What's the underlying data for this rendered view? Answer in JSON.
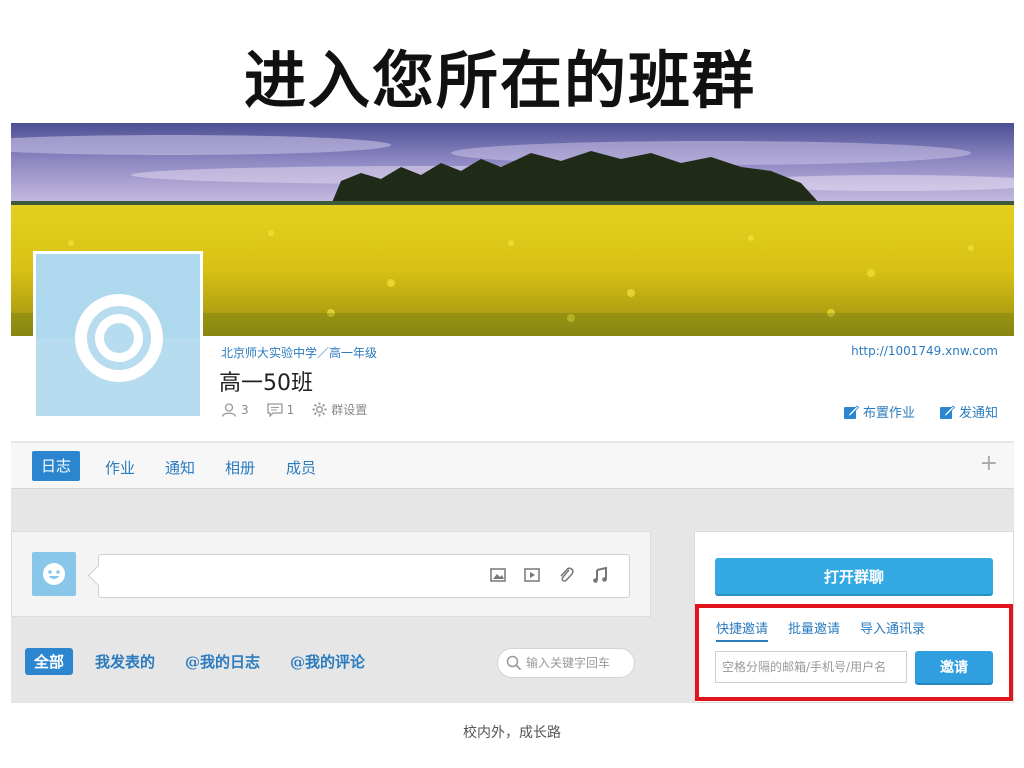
{
  "slide": {
    "title": "进入您所在的班群",
    "footer": "校内外，成长路"
  },
  "header": {
    "school_path": "北京师大实验中学／高一年级",
    "class_name": "高一50班",
    "url": "http://1001749.xnw.com",
    "stats": {
      "members": "3",
      "messages": "1",
      "settings_label": "群设置"
    },
    "actions": {
      "assign_homework": "布置作业",
      "send_notice": "发通知"
    }
  },
  "tabs": [
    {
      "label": "日志",
      "active": true
    },
    {
      "label": "作业",
      "active": false
    },
    {
      "label": "通知",
      "active": false
    },
    {
      "label": "相册",
      "active": false
    },
    {
      "label": "成员",
      "active": false
    }
  ],
  "tab_add": "+",
  "filters": [
    {
      "label": "全部",
      "active": true
    },
    {
      "label": "我发表的",
      "active": false
    },
    {
      "label": "@我的日志",
      "active": false
    },
    {
      "label": "@我的评论",
      "active": false
    }
  ],
  "search": {
    "placeholder": "输入关键字回车"
  },
  "panel": {
    "open_chat": "打开群聊",
    "invite_tabs": [
      {
        "label": "快捷邀请",
        "active": true
      },
      {
        "label": "批量邀请",
        "active": false
      },
      {
        "label": "导入通讯录",
        "active": false
      }
    ],
    "invite_placeholder": "空格分隔的邮箱/手机号/用户名",
    "invite_button": "邀请"
  },
  "colors": {
    "brand_blue": "#2b86cf",
    "link_blue": "#2b7bbf",
    "highlight_red": "#e3131b"
  }
}
